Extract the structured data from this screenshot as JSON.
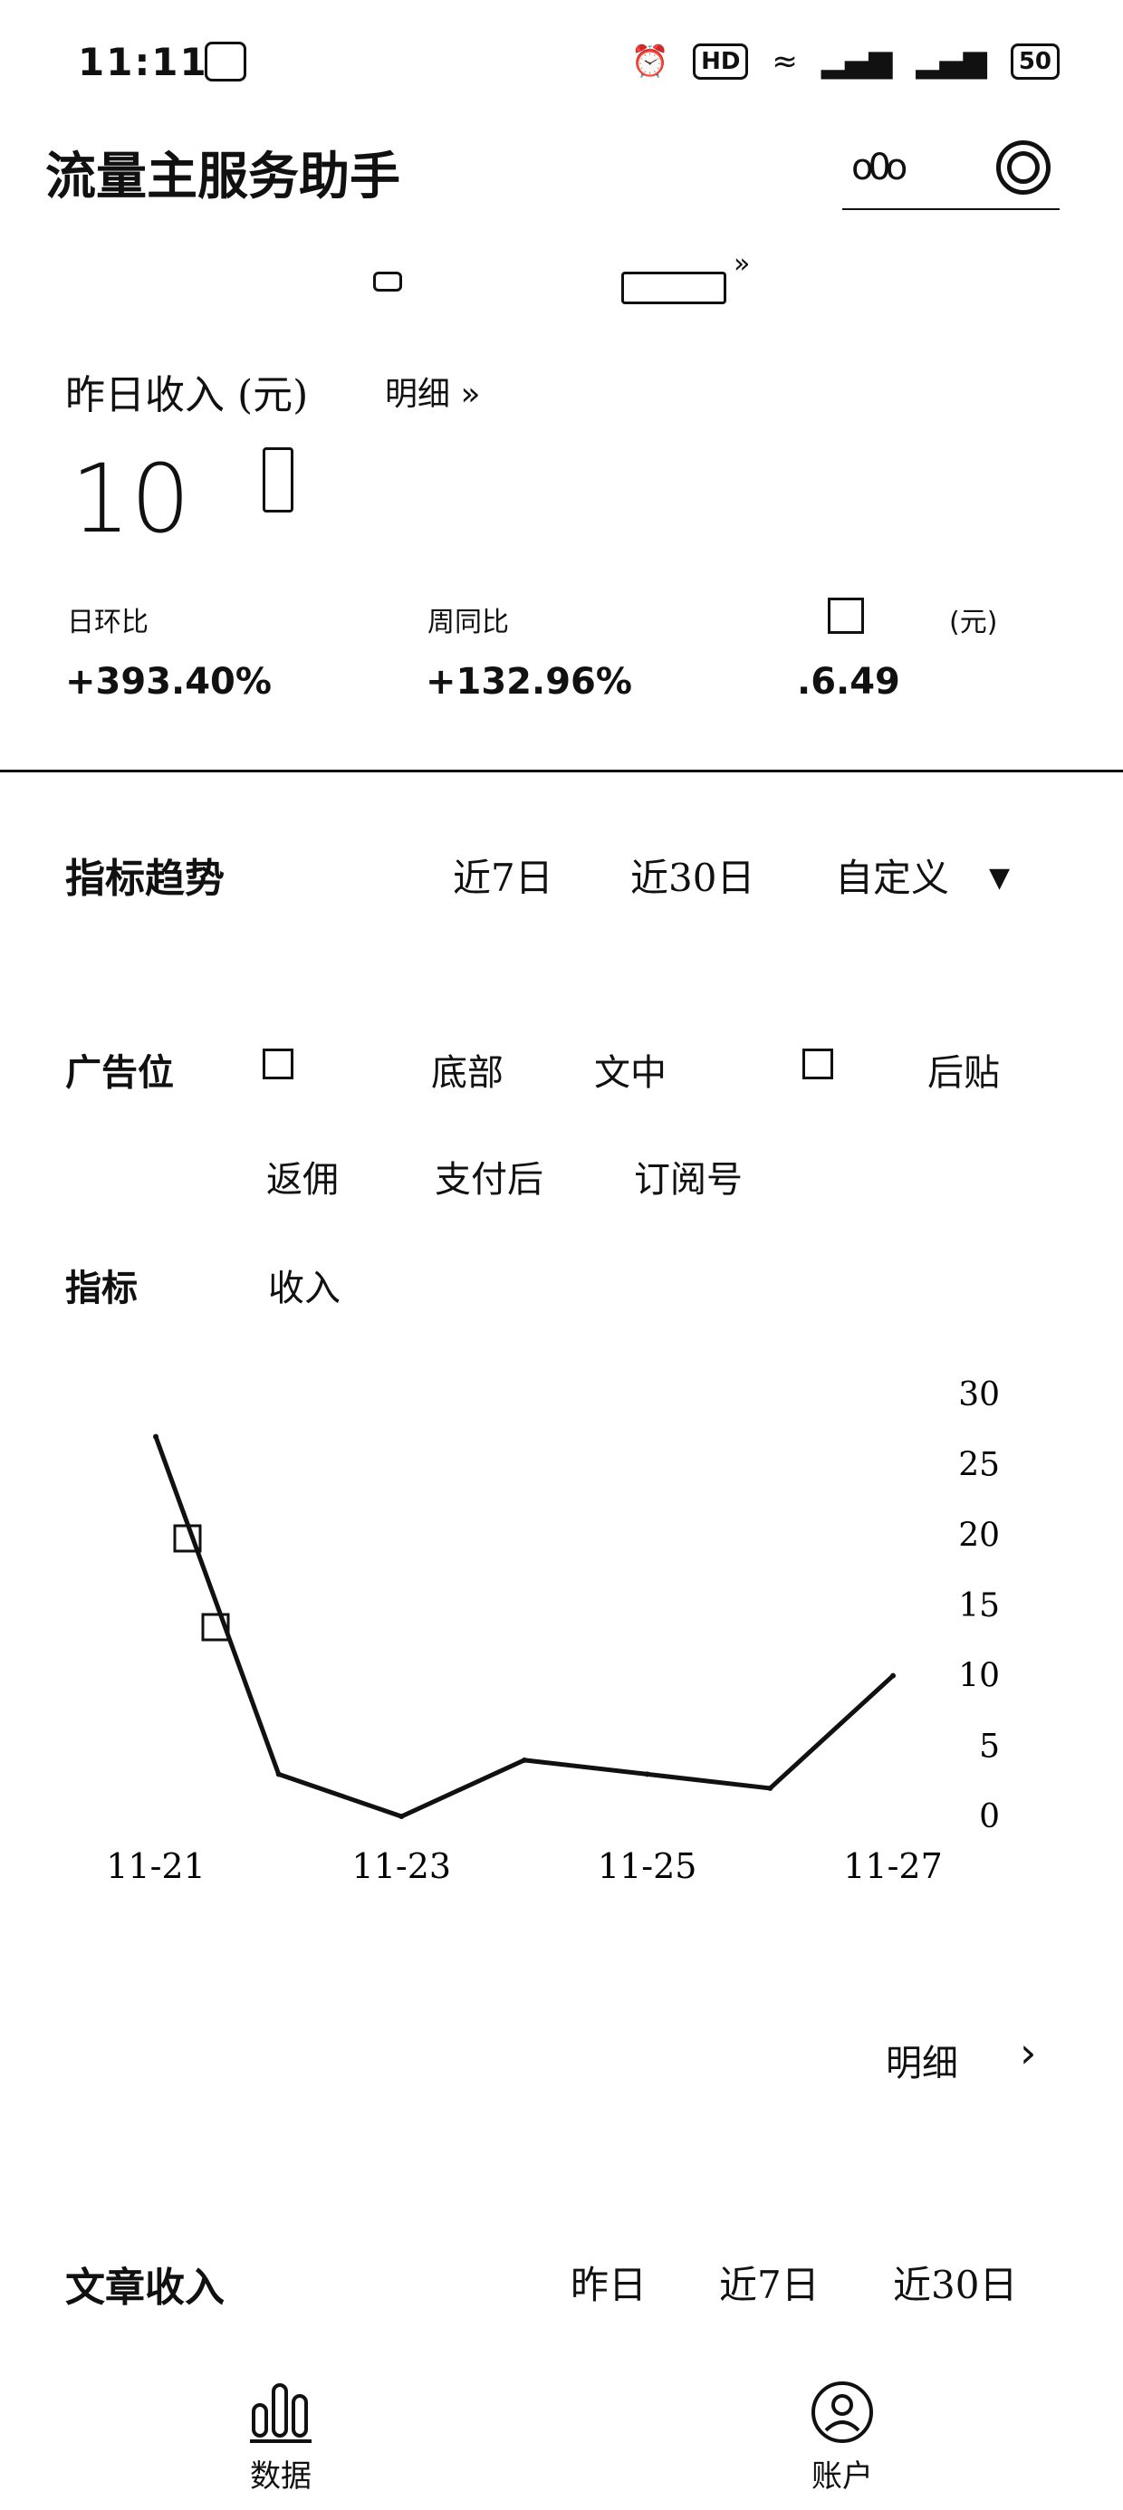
{
  "status_bar": {
    "time": "11:11",
    "icons": [
      "alarm-icon",
      "hd-icon",
      "wifi-icon",
      "signal-icon",
      "signal-icon",
      "battery-icon"
    ],
    "hd_label": "HD",
    "battery": "50"
  },
  "header": {
    "title": "流量主服务助手"
  },
  "income": {
    "label": "昨日收入 (元)",
    "detail_link": "明细 »",
    "value": "10",
    "metrics": [
      {
        "label": "日环比",
        "value": "+393.40%"
      },
      {
        "label": "周同比",
        "value": "+132.96%"
      },
      {
        "label": "(元)",
        "value": ".6.49"
      }
    ]
  },
  "trend": {
    "title": "指标趋势",
    "tabs": [
      "近7日",
      "近30日",
      "自定义"
    ],
    "ad_label": "广告位",
    "ad_options": [
      "底部",
      "文中",
      "后贴",
      "返佣",
      "支付后",
      "订阅号"
    ],
    "metric_label": "指标",
    "metric_value": "收入"
  },
  "chart_data": {
    "type": "line",
    "title": "",
    "xlabel": "",
    "ylabel": "",
    "x": [
      "11-21",
      "11-22",
      "11-23",
      "11-24",
      "11-25",
      "11-26",
      "11-27"
    ],
    "series": [
      {
        "values": [
          27,
          3,
          0,
          4,
          3,
          2,
          10
        ]
      }
    ],
    "x_ticks": [
      "11-21",
      "11-23",
      "11-25",
      "11-27"
    ],
    "y_ticks": [
      0,
      5,
      10,
      15,
      20,
      25,
      30
    ],
    "ylim": [
      0,
      30
    ],
    "grid": false,
    "y_axis_side": "right"
  },
  "bottom_link": {
    "label": "明细"
  },
  "article": {
    "title": "文章收入",
    "tabs": [
      "昨日",
      "近7日",
      "近30日"
    ]
  },
  "tabbar": [
    {
      "label": "数据",
      "icon": "bar-chart-icon"
    },
    {
      "label": "账户",
      "icon": "user-icon"
    }
  ]
}
